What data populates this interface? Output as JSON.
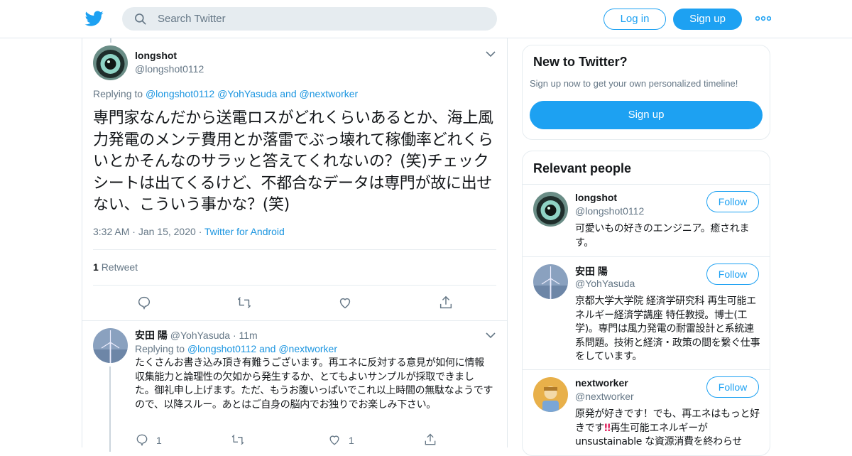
{
  "header": {
    "search_placeholder": "Search Twitter",
    "login_label": "Log in",
    "signup_label": "Sign up",
    "brand_color": "#1da1f2",
    "logo_icon": "twitter-bird-icon",
    "more_icon": "more-dots-icon"
  },
  "tweet": {
    "name": "longshot",
    "handle": "@longshot0112",
    "replying_prefix": "Replying to ",
    "replying_to": [
      "@longshot0112",
      "@YohYasuda",
      "@nextworker"
    ],
    "replying_and": "and",
    "text": "専門家なんだから送電ロスがどれくらいあるとか、海上風力発電のメンテ費用とか落雷でぶっ壊れて稼働率どれくらいとかそんなのサラッと答えてくれないの？(笑)チェックシートは出てくるけど、不都合なデータは専門が故に出せない、こういう事かな？(笑)",
    "time": "3:32 AM",
    "date": "Jan 15, 2020",
    "source": "Twitter for Android",
    "retweet_count": "1",
    "retweet_label": "Retweet"
  },
  "reply": {
    "name": "安田 陽",
    "handle": "@YohYasuda",
    "time": "11m",
    "replying_prefix": "Replying to ",
    "replying_to": [
      "@longshot0112",
      "@nextworker"
    ],
    "replying_and": "and",
    "text": "たくさんお書き込み頂き有難うございます。再エネに反対する意見が如何に情報収集能力と論理性の欠如から発生するか、とてもよいサンプルが採取できました。御礼申し上げます。ただ、もうお腹いっぱいでこれ以上時間の無駄なようですので、以降スルー。あとはご自身の脳内でお独りでお楽しみ下さい。",
    "reply_count": "1",
    "like_count": "1"
  },
  "sidebar": {
    "new_title": "New to Twitter?",
    "new_text": "Sign up now to get your own personalized timeline!",
    "new_signup": "Sign up",
    "people_title": "Relevant people",
    "people": [
      {
        "name": "longshot",
        "handle": "@longshot0112",
        "follow": "Follow",
        "bio": "可愛いもの好きのエンジニア。癒されます。"
      },
      {
        "name": "安田 陽",
        "handle": "@YohYasuda",
        "follow": "Follow",
        "bio": "京都大学大学院 経済学研究科 再生可能エネルギー経済学講座 特任教授。博士(工学)。専門は風力発電の耐雷設計と系統連系問題。技術と経済・政策の間を繋ぐ仕事をしています。"
      },
      {
        "name": "nextworker",
        "handle": "@nextworker",
        "follow": "Follow",
        "bio_part1": "原発が好きです！でも、再エネはもっと好きです",
        "bio_emoji": "‼",
        "bio_part2": "再生可能エネルギーがunsustainable な資源消費を終わらせ"
      }
    ]
  }
}
